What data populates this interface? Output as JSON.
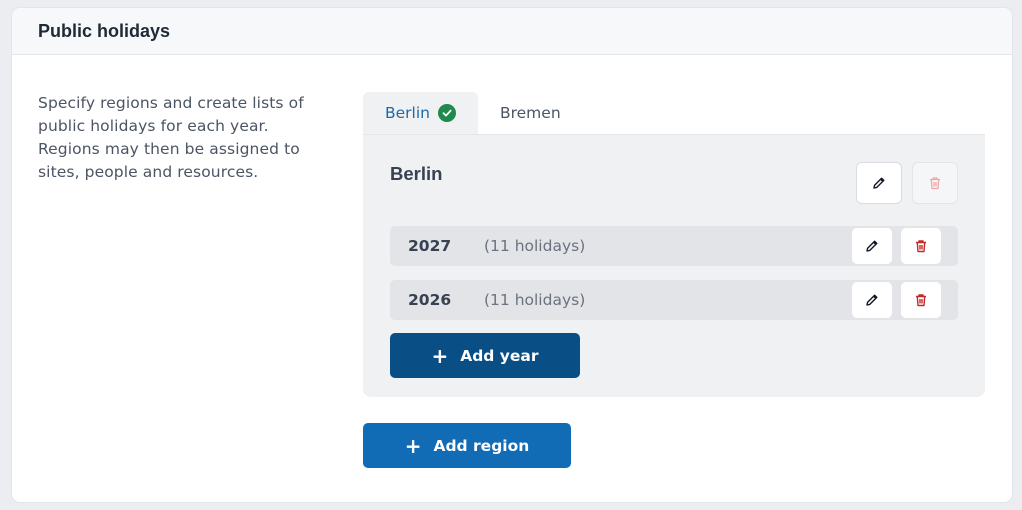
{
  "card": {
    "title": "Public holidays"
  },
  "description": "Specify regions and create lists of public holidays for each year. Regions may then be assigned to sites, people and resources.",
  "tabs": [
    {
      "label": "Berlin",
      "active": true,
      "status": "check-icon"
    },
    {
      "label": "Bremen",
      "active": false
    }
  ],
  "region": {
    "name": "Berlin",
    "years": [
      {
        "year": "2027",
        "count": "(11 holidays)"
      },
      {
        "year": "2026",
        "count": "(11 holidays)"
      }
    ],
    "add_year_label": "Add year"
  },
  "add_region_label": "Add region",
  "colors": {
    "accent": "#126bb5",
    "accent_dark": "#0a4e86",
    "success": "#1f8a4c",
    "danger": "#c62828"
  }
}
